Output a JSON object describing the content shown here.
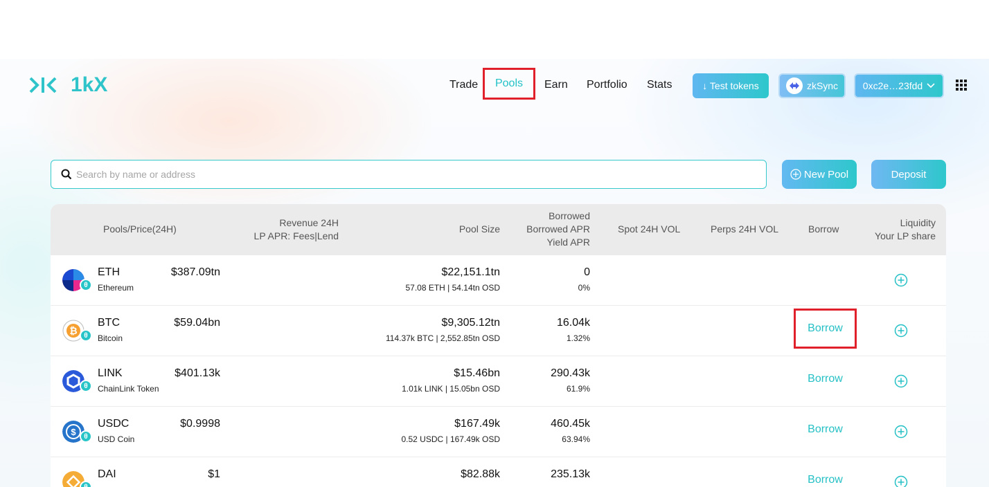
{
  "header": {
    "logo_text": "1kX",
    "nav": [
      "Trade",
      "Pools",
      "Earn",
      "Portfolio",
      "Stats"
    ],
    "test_tokens": "↓ Test tokens",
    "network": "zkSync",
    "wallet": "0xc2e…23fdd",
    "active_nav": "Pools",
    "accent": "#2fc4c9",
    "highlight": "#e0202a"
  },
  "search": {
    "placeholder": "Search by name or address",
    "new_pool": "New Pool",
    "deposit": "Deposit"
  },
  "table": {
    "headers": {
      "pools": "Pools/Price(24H)",
      "revenue_1": "Revenue 24H",
      "revenue_2": "LP APR: Fees|Lend",
      "pool_size": "Pool Size",
      "borrowed_1": "Borrowed",
      "borrowed_2": "Borrowed APR",
      "borrowed_3": "Yield APR",
      "spot": "Spot 24H VOL",
      "perps": "Perps 24H VOL",
      "borrow": "Borrow",
      "liquidity_1": "Liquidity",
      "liquidity_2": "Your LP share"
    },
    "rows": [
      {
        "symbol": "ETH",
        "name": "Ethereum",
        "price": "$387.09tn",
        "pool_size": "$22,151.1tn",
        "pool_sub": "57.08 ETH | 54.14tn OSD",
        "borrowed": "0",
        "borrowed_apr": "0%",
        "borrow": "",
        "icon": "eth-icon"
      },
      {
        "symbol": "BTC",
        "name": "Bitcoin",
        "price": "$59.04bn",
        "pool_size": "$9,305.12tn",
        "pool_sub": "114.37k BTC | 2,552.85tn OSD",
        "borrowed": "16.04k",
        "borrowed_apr": "1.32%",
        "borrow": "Borrow",
        "icon": "btc-icon"
      },
      {
        "symbol": "LINK",
        "name": "ChainLink Token",
        "price": "$401.13k",
        "pool_size": "$15.46bn",
        "pool_sub": "1.01k LINK | 15.05bn OSD",
        "borrowed": "290.43k",
        "borrowed_apr": "61.9%",
        "borrow": "Borrow",
        "icon": "link-icon"
      },
      {
        "symbol": "USDC",
        "name": "USD Coin",
        "price": "$0.9998",
        "pool_size": "$167.49k",
        "pool_sub": "0.52 USDC | 167.49k OSD",
        "borrowed": "460.45k",
        "borrowed_apr": "63.94%",
        "borrow": "Borrow",
        "icon": "usdc-icon"
      },
      {
        "symbol": "DAI",
        "name": "",
        "price": "$1",
        "pool_size": "$82.88k",
        "pool_sub": "",
        "borrowed": "235.13k",
        "borrowed_apr": "",
        "borrow": "Borrow",
        "icon": "dai-icon"
      }
    ]
  }
}
